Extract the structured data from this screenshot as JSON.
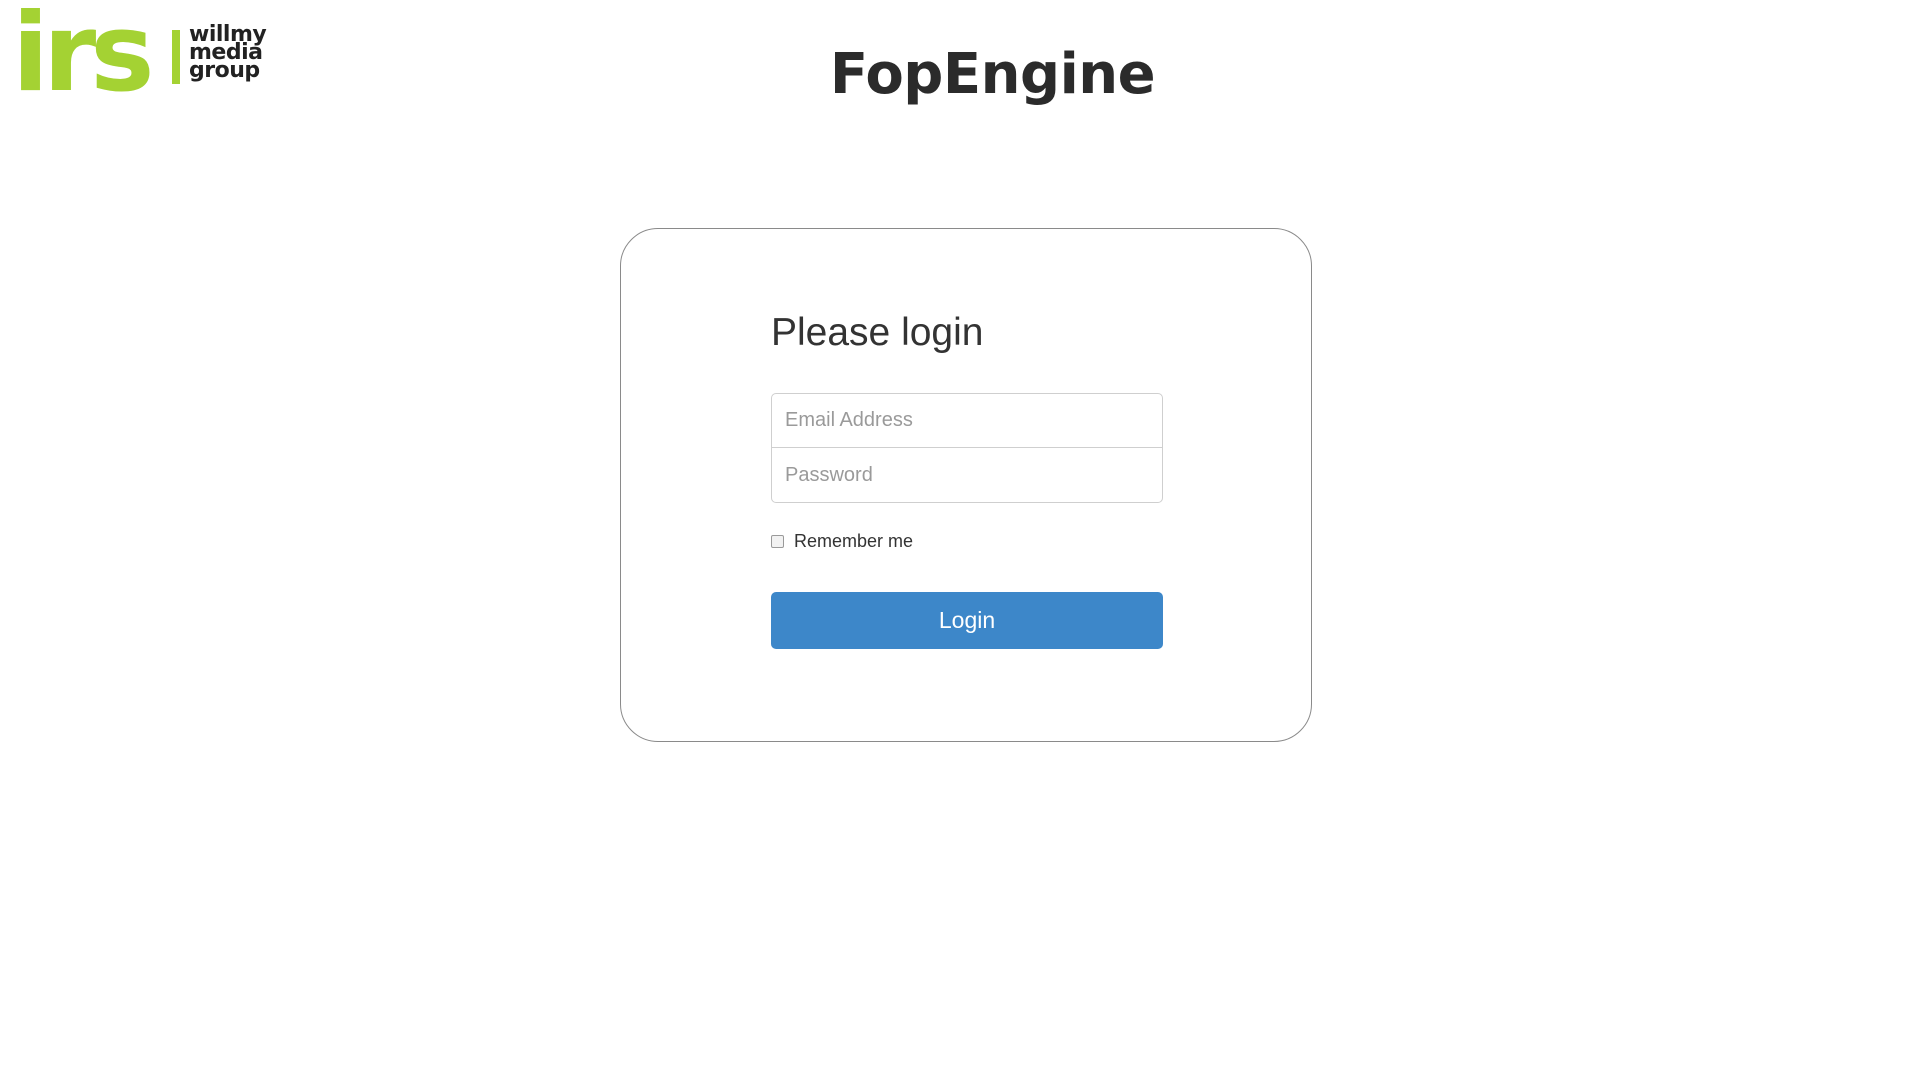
{
  "header": {
    "logo_irs_text": "irs",
    "logo_willmy_lines": [
      "willmy",
      "media",
      "group"
    ],
    "app_title": "FopEngine"
  },
  "login": {
    "heading": "Please login",
    "email_placeholder": "Email Address",
    "email_value": "",
    "password_placeholder": "Password",
    "password_value": "",
    "remember_label": "Remember me",
    "remember_checked": false,
    "button_label": "Login"
  },
  "colors": {
    "brand_green": "#a4d233",
    "button_blue": "#3d87c9",
    "title_text": "#2b2b2b",
    "card_border": "#8a8a8a"
  }
}
